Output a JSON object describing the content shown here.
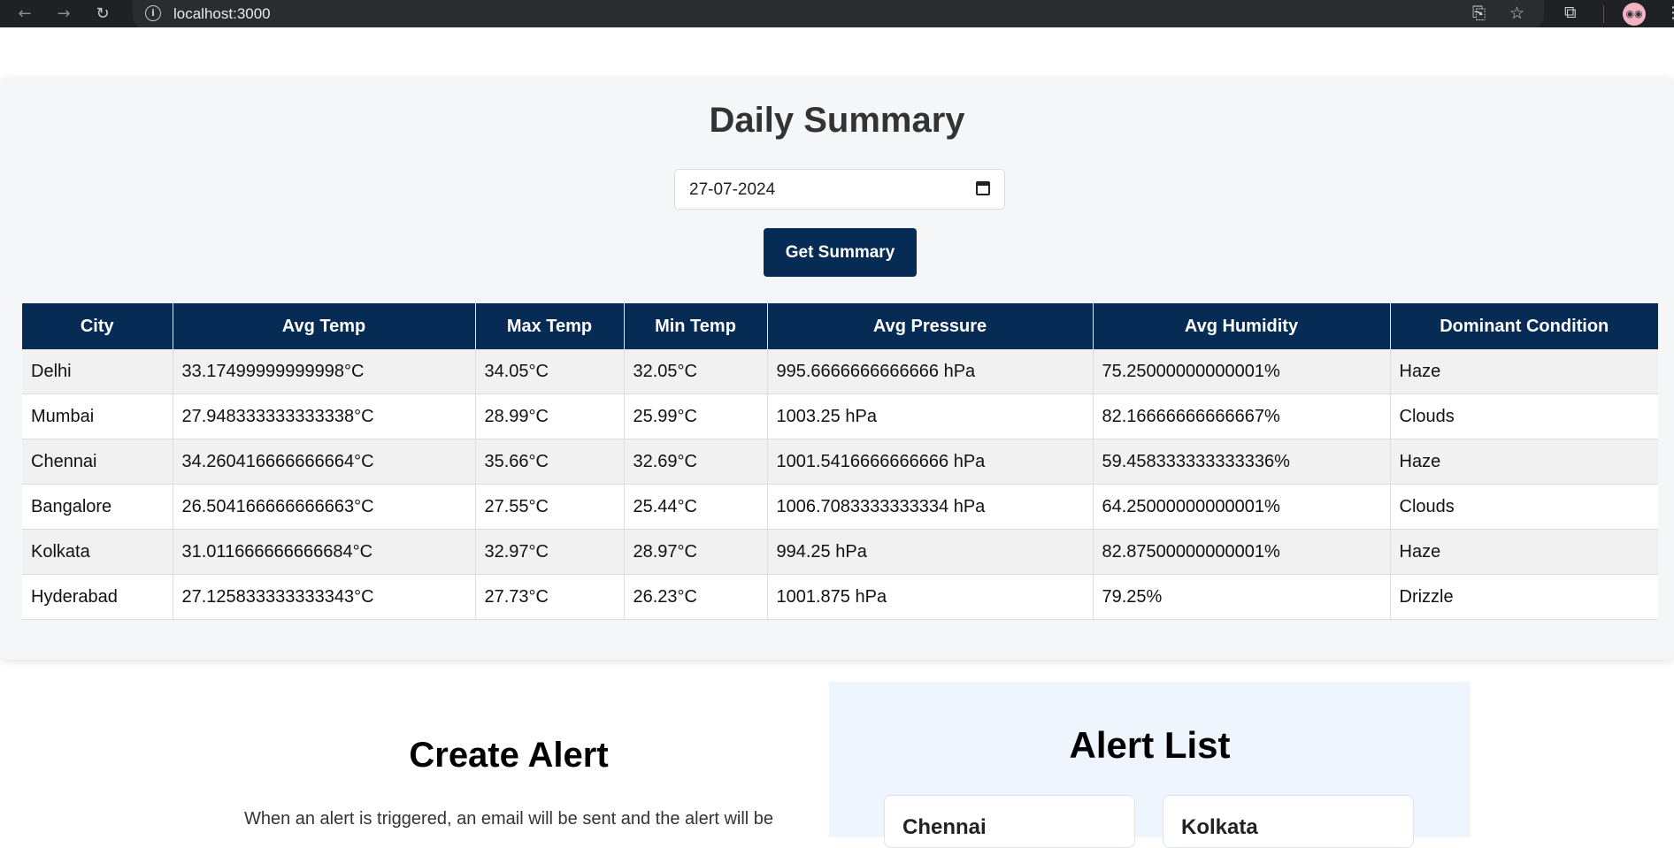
{
  "browser": {
    "url": "localhost:3000",
    "icons": [
      "back-icon",
      "forward-icon",
      "reload-icon",
      "info-icon",
      "install-icon",
      "star-icon",
      "extensions-icon",
      "profile-avatar",
      "menu-icon"
    ]
  },
  "summary": {
    "title": "Daily Summary",
    "date_value": "27-07-2024",
    "button_label": "Get Summary",
    "columns": [
      "City",
      "Avg Temp",
      "Max Temp",
      "Min Temp",
      "Avg Pressure",
      "Avg Humidity",
      "Dominant Condition"
    ],
    "rows": [
      [
        "Delhi",
        "33.17499999999998°C",
        "34.05°C",
        "32.05°C",
        "995.6666666666666 hPa",
        "75.25000000000001%",
        "Haze"
      ],
      [
        "Mumbai",
        "27.948333333333338°C",
        "28.99°C",
        "25.99°C",
        "1003.25 hPa",
        "82.16666666666667%",
        "Clouds"
      ],
      [
        "Chennai",
        "34.260416666666664°C",
        "35.66°C",
        "32.69°C",
        "1001.5416666666666 hPa",
        "59.458333333333336%",
        "Haze"
      ],
      [
        "Bangalore",
        "26.504166666666663°C",
        "27.55°C",
        "25.44°C",
        "1006.7083333333334 hPa",
        "64.25000000000001%",
        "Clouds"
      ],
      [
        "Kolkata",
        "31.011666666666684°C",
        "32.97°C",
        "28.97°C",
        "994.25 hPa",
        "82.87500000000001%",
        "Haze"
      ],
      [
        "Hyderabad",
        "27.125833333333343°C",
        "27.73°C",
        "26.23°C",
        "1001.875 hPa",
        "79.25%",
        "Drizzle"
      ]
    ]
  },
  "create_alert": {
    "title": "Create Alert",
    "description": "When an alert is triggered, an email will be sent and the alert will be"
  },
  "alert_list": {
    "title": "Alert List",
    "cards": [
      {
        "city": "Chennai"
      },
      {
        "city": "Kolkata"
      }
    ]
  },
  "colors": {
    "header_bg": "#062b54",
    "panel_bg": "#f5f6f8",
    "alert_panel_bg": "#eef5fd"
  }
}
